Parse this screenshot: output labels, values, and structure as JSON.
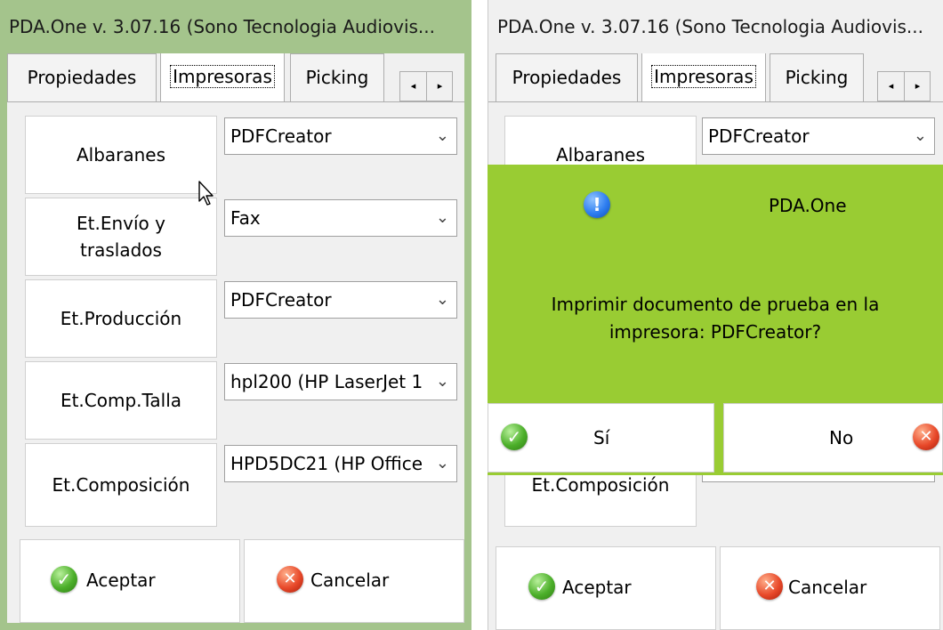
{
  "left_window": {
    "title": "PDA.One  v. 3.07.16  (Sono Tecnologia Audiovis...",
    "tabs": [
      {
        "label": "Propiedades",
        "active": false
      },
      {
        "label": "Impresoras",
        "active": true
      },
      {
        "label": "Picking",
        "active": false
      }
    ],
    "rows": [
      {
        "label": "Albaranes",
        "printer": "PDFCreator"
      },
      {
        "label": "Et.Envío y traslados",
        "printer": "Fax"
      },
      {
        "label": "Et.Producción",
        "printer": "PDFCreator"
      },
      {
        "label": "Et.Comp.Talla",
        "printer": "hpl200 (HP LaserJet 1"
      },
      {
        "label": "Et.Composición",
        "printer": "HPD5DC21 (HP Office"
      }
    ],
    "accept_label": "Aceptar",
    "cancel_label": "Cancelar"
  },
  "right_window": {
    "title": "PDA.One  v. 3.07.16  (Sono Tecnologia Audiovis...",
    "tabs": [
      {
        "label": "Propiedades",
        "active": false
      },
      {
        "label": "Impresoras",
        "active": true
      },
      {
        "label": "Picking",
        "active": false
      }
    ],
    "rows": [
      {
        "label": "Albaranes",
        "printer": "PDFCreator"
      },
      {
        "label": "Et.Composición",
        "printer": ""
      }
    ],
    "accept_label": "Aceptar",
    "cancel_label": "Cancelar"
  },
  "dialog": {
    "title": "PDA.One",
    "message_line1": "Imprimir documento de prueba en la",
    "message_line2": "impresora: PDFCreator?",
    "yes_label": "Sí",
    "no_label": "No",
    "background_color": "#99cc33"
  },
  "icons": {
    "ok": "checkmark-icon",
    "cancel": "x-icon",
    "info": "exclamation-icon",
    "scroll_left": "◂",
    "scroll_right": "▸",
    "chevron": "⌄"
  },
  "colors": {
    "window_frame_active": "#a4c48c",
    "client_background": "#f0f0f0",
    "dialog_green": "#99cc33"
  }
}
